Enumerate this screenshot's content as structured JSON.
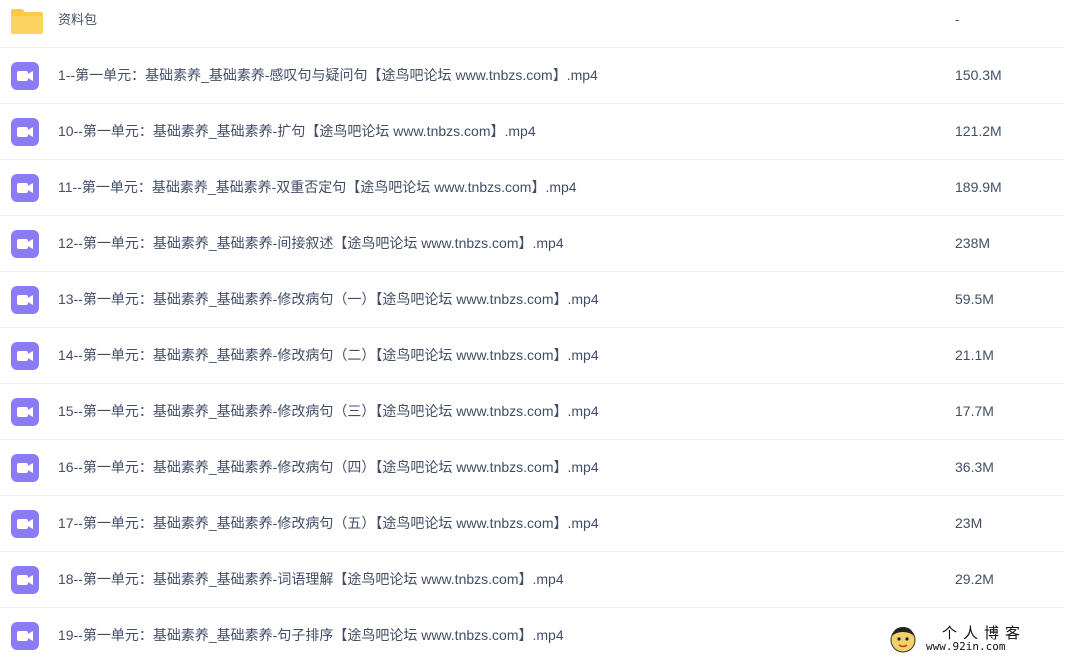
{
  "files": [
    {
      "name": "资料包",
      "size": "-",
      "type": "folder"
    },
    {
      "name": "1--第一单元：基础素养_基础素养-感叹句与疑问句【途鸟吧论坛 www.tnbzs.com】.mp4",
      "size": "150.3M",
      "type": "video"
    },
    {
      "name": "10--第一单元：基础素养_基础素养-扩句【途鸟吧论坛 www.tnbzs.com】.mp4",
      "size": "121.2M",
      "type": "video"
    },
    {
      "name": "11--第一单元：基础素养_基础素养-双重否定句【途鸟吧论坛 www.tnbzs.com】.mp4",
      "size": "189.9M",
      "type": "video"
    },
    {
      "name": "12--第一单元：基础素养_基础素养-间接叙述【途鸟吧论坛 www.tnbzs.com】.mp4",
      "size": "238M",
      "type": "video"
    },
    {
      "name": "13--第一单元：基础素养_基础素养-修改病句（一）【途鸟吧论坛 www.tnbzs.com】.mp4",
      "size": "59.5M",
      "type": "video"
    },
    {
      "name": "14--第一单元：基础素养_基础素养-修改病句（二）【途鸟吧论坛 www.tnbzs.com】.mp4",
      "size": "21.1M",
      "type": "video"
    },
    {
      "name": "15--第一单元：基础素养_基础素养-修改病句（三）【途鸟吧论坛 www.tnbzs.com】.mp4",
      "size": "17.7M",
      "type": "video"
    },
    {
      "name": "16--第一单元：基础素养_基础素养-修改病句（四）【途鸟吧论坛 www.tnbzs.com】.mp4",
      "size": "36.3M",
      "type": "video"
    },
    {
      "name": "17--第一单元：基础素养_基础素养-修改病句（五）【途鸟吧论坛 www.tnbzs.com】.mp4",
      "size": "23M",
      "type": "video"
    },
    {
      "name": "18--第一单元：基础素养_基础素养-词语理解【途鸟吧论坛 www.tnbzs.com】.mp4",
      "size": "29.2M",
      "type": "video"
    },
    {
      "name": "19--第一单元：基础素养_基础素养-句子排序【途鸟吧论坛 www.tnbzs.com】.mp4",
      "size": "",
      "type": "video"
    }
  ],
  "watermark": {
    "title": "个人博客",
    "url": "www.92in.com"
  },
  "colors": {
    "folder": "#fcc94a",
    "video": "#8b7cf6",
    "text": "#424e67",
    "divider": "#eef0f3"
  },
  "icons": {
    "folder": "folder-icon",
    "video": "video-file-icon"
  }
}
